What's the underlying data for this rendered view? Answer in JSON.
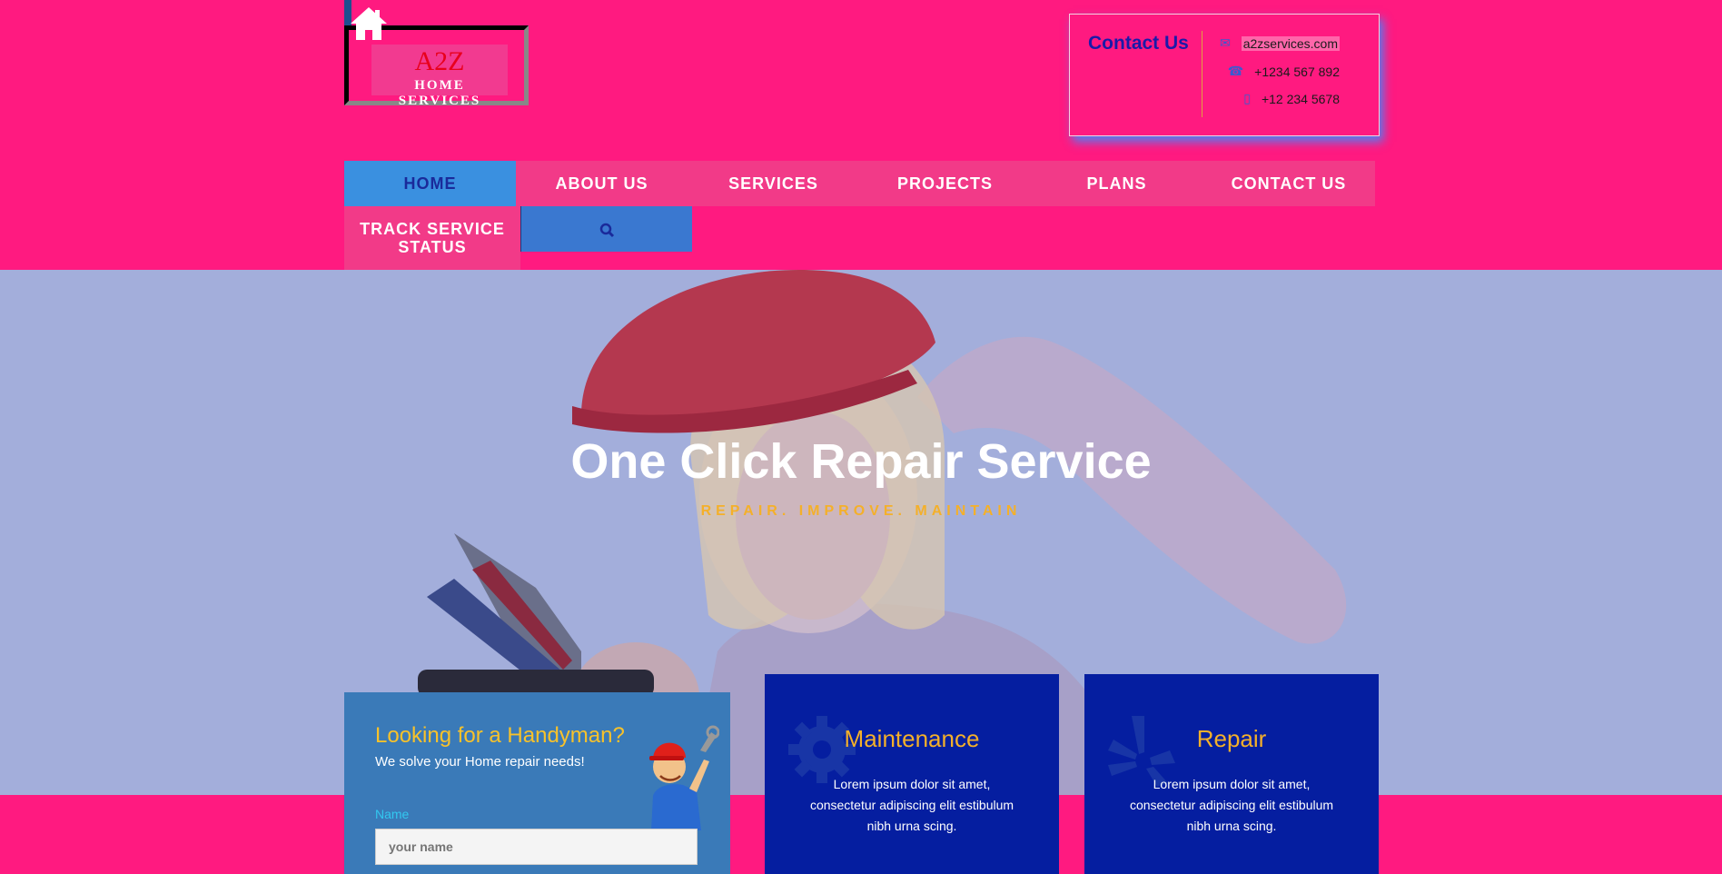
{
  "brand": {
    "name": "A2Z",
    "tagline": "HOME SERVICES"
  },
  "contact": {
    "title": "Contact Us",
    "email": "a2zservices.com",
    "phone1": "+1234 567 892",
    "phone2": "+12 234 5678",
    "icons": [
      "envelope-icon",
      "phone-icon",
      "mobile-icon"
    ]
  },
  "nav": {
    "items": [
      {
        "label": "HOME",
        "active": true
      },
      {
        "label": "ABOUT US"
      },
      {
        "label": "SERVICES"
      },
      {
        "label": "PROJECTS"
      },
      {
        "label": "PLANS"
      },
      {
        "label": "CONTACT US"
      }
    ],
    "track_line1": "TRACK SERVICE",
    "track_line2": "STATUS",
    "search_icon": "search-icon"
  },
  "hero": {
    "title": "One Click Repair Service",
    "subtitle": "REPAIR. IMPROVE. MAINTAIN"
  },
  "form": {
    "title": "Looking for a Handyman?",
    "subtitle": "We solve your Home repair needs!",
    "name_label": "Name",
    "name_placeholder": "your name"
  },
  "services": [
    {
      "title": "Maintenance",
      "text": "Lorem ipsum dolor sit amet, consectetur adipiscing elit estibulum nibh urna scing.",
      "icon": "gear-icon"
    },
    {
      "title": "Repair",
      "text": "Lorem ipsum dolor sit amet, consectetur adipiscing elit estibulum nibh urna scing.",
      "icon": "yelp-icon"
    }
  ],
  "colors": {
    "page_background": "#ff1a80",
    "accent": "#f4b02a",
    "nav_active": "#3a90e0",
    "card": "#051ea0"
  }
}
